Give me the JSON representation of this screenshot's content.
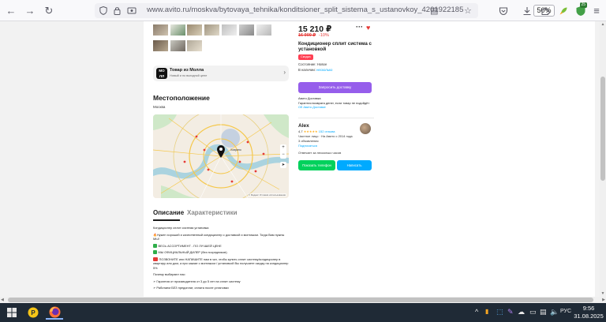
{
  "browser": {
    "url": "www.avito.ru/moskva/bytovaya_tehnika/konditsioner_split_sistema_s_ustanovkoy_4201922185",
    "zoom": "50%",
    "extension_badge": "25"
  },
  "mall": {
    "logo": "МО ЛЛ",
    "title": "Товар из Молла",
    "subtitle": "Новый и по выгодной цене"
  },
  "location": {
    "heading": "Местоположение",
    "city": "Москва",
    "map_marker": "Ховрино",
    "map_attribution": "© Яндекс Условия использования"
  },
  "tabs": {
    "description": "Описание",
    "specs": "Характеристики"
  },
  "description": {
    "p1": "Кондиционер сплит система установка",
    "p2": "Нужен хороший и качественный кондиционер с доставкой и монтажом. Тогда Вам нужны МЫ!",
    "p3": "ВЕСЬ АССОРТИМЕНТ - ПО ЛУЧШЕЙ ЦЕНЕ",
    "p4": "МЫ ОФИЦИАЛЬНЫЙ ДИЛЕР (без посредников)",
    "p5": "ПОЗВОНИТЕ или НАПИШИТЕ нам в чат, чтобы купить сплит систему/кондиционер в квартиру или дом, а при заказе с монтажом / установкой Вы получаете скидку на кондиционер 5%",
    "p6": "Почему выбирают нас:",
    "p7": "➢ Гарантия от производителя от 3 до 5 лет на сплит систему",
    "p8": "➢ Работаем БЕЗ предоплат, оплата после установки"
  },
  "product": {
    "price": "15 210 ₽",
    "old_price": "16 900 ₽",
    "discount": "-10%",
    "title": "Кондиционер сплит система с установкой",
    "badge": "Скидка",
    "condition": "Состояние: Новое",
    "availability_label": "В наличии:",
    "availability_value": "несколько",
    "request_button": "Запросить доставку",
    "delivery_title": "Авито Доставка",
    "delivery_note": "Гарантия возврата денег, если товар не подойдёт",
    "delivery_link": "Об Авито Доставке"
  },
  "seller": {
    "name": "Alex",
    "rating": "4,7",
    "stars": "★★★★★",
    "reviews": "152 отзыва",
    "type": "Частное лицо · На Авито с 2014 года",
    "ads": "3 объявления",
    "subscribe": "Подписаться",
    "response": "Отвечает за несколько часов",
    "phone_button": "Показать телефон",
    "write_button": "Написать"
  },
  "taskbar": {
    "language": "РУС",
    "time": "9:56",
    "date": "31.08.2025"
  },
  "colors": {
    "purple": "#965eeb",
    "green": "#02d15c",
    "blue": "#00aaff",
    "red": "#e53935"
  }
}
